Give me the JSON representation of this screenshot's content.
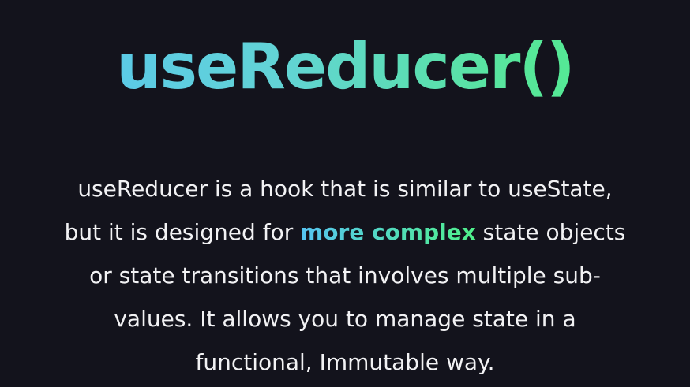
{
  "slide": {
    "title": "useReducer()",
    "lines": [
      "useReducer is a hook that is similar to useState,",
      "but it is designed for ",
      " state objects",
      "or state transitions that involves multiple sub-",
      "values. It allows you to manage state in a",
      "functional, Immutable way."
    ],
    "highlight": "more complex",
    "colors": {
      "background": "#13131c",
      "text": "#f2f2f4",
      "gradient_start": "#56c4f2",
      "gradient_end": "#4ff08a"
    }
  }
}
